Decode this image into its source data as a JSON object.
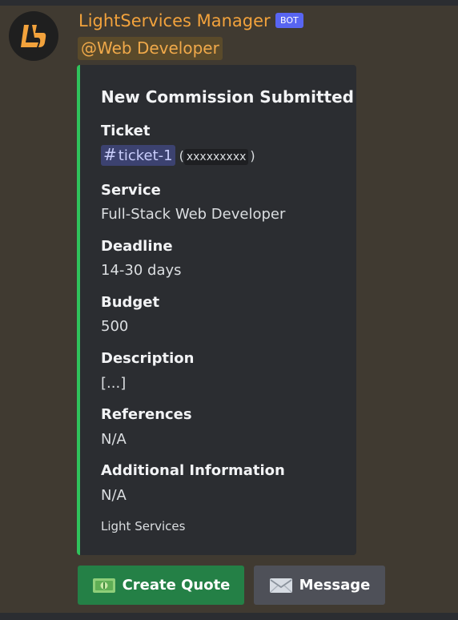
{
  "message": {
    "author": "LightServices Manager",
    "bot_tag": "BOT",
    "mention": "@Web Developer",
    "avatar_icon": "lightservices-logo-icon"
  },
  "embed": {
    "accent_color": "#2fc35c",
    "title": "New Commission Submitted",
    "fields": [
      {
        "name": "Ticket",
        "channel_hash": "#",
        "channel_name": "ticket-1",
        "paren_open": "(",
        "channel_id": "xxxxxxxxx",
        "paren_close": ")"
      },
      {
        "name": "Service",
        "value": "Full-Stack Web Developer"
      },
      {
        "name": "Deadline",
        "value": "14-30 days"
      },
      {
        "name": "Budget",
        "value": "500"
      },
      {
        "name": "Description",
        "value": "[...]"
      },
      {
        "name": "References",
        "value": "N/A"
      },
      {
        "name": "Additional Information",
        "value": "N/A"
      }
    ],
    "footer": "Light Services"
  },
  "buttons": {
    "create_quote": {
      "label": "Create Quote",
      "icon": "dollar-banknote-icon",
      "color": "#248046"
    },
    "message": {
      "label": "Message",
      "icon": "envelope-icon",
      "color": "#4e5058"
    }
  }
}
